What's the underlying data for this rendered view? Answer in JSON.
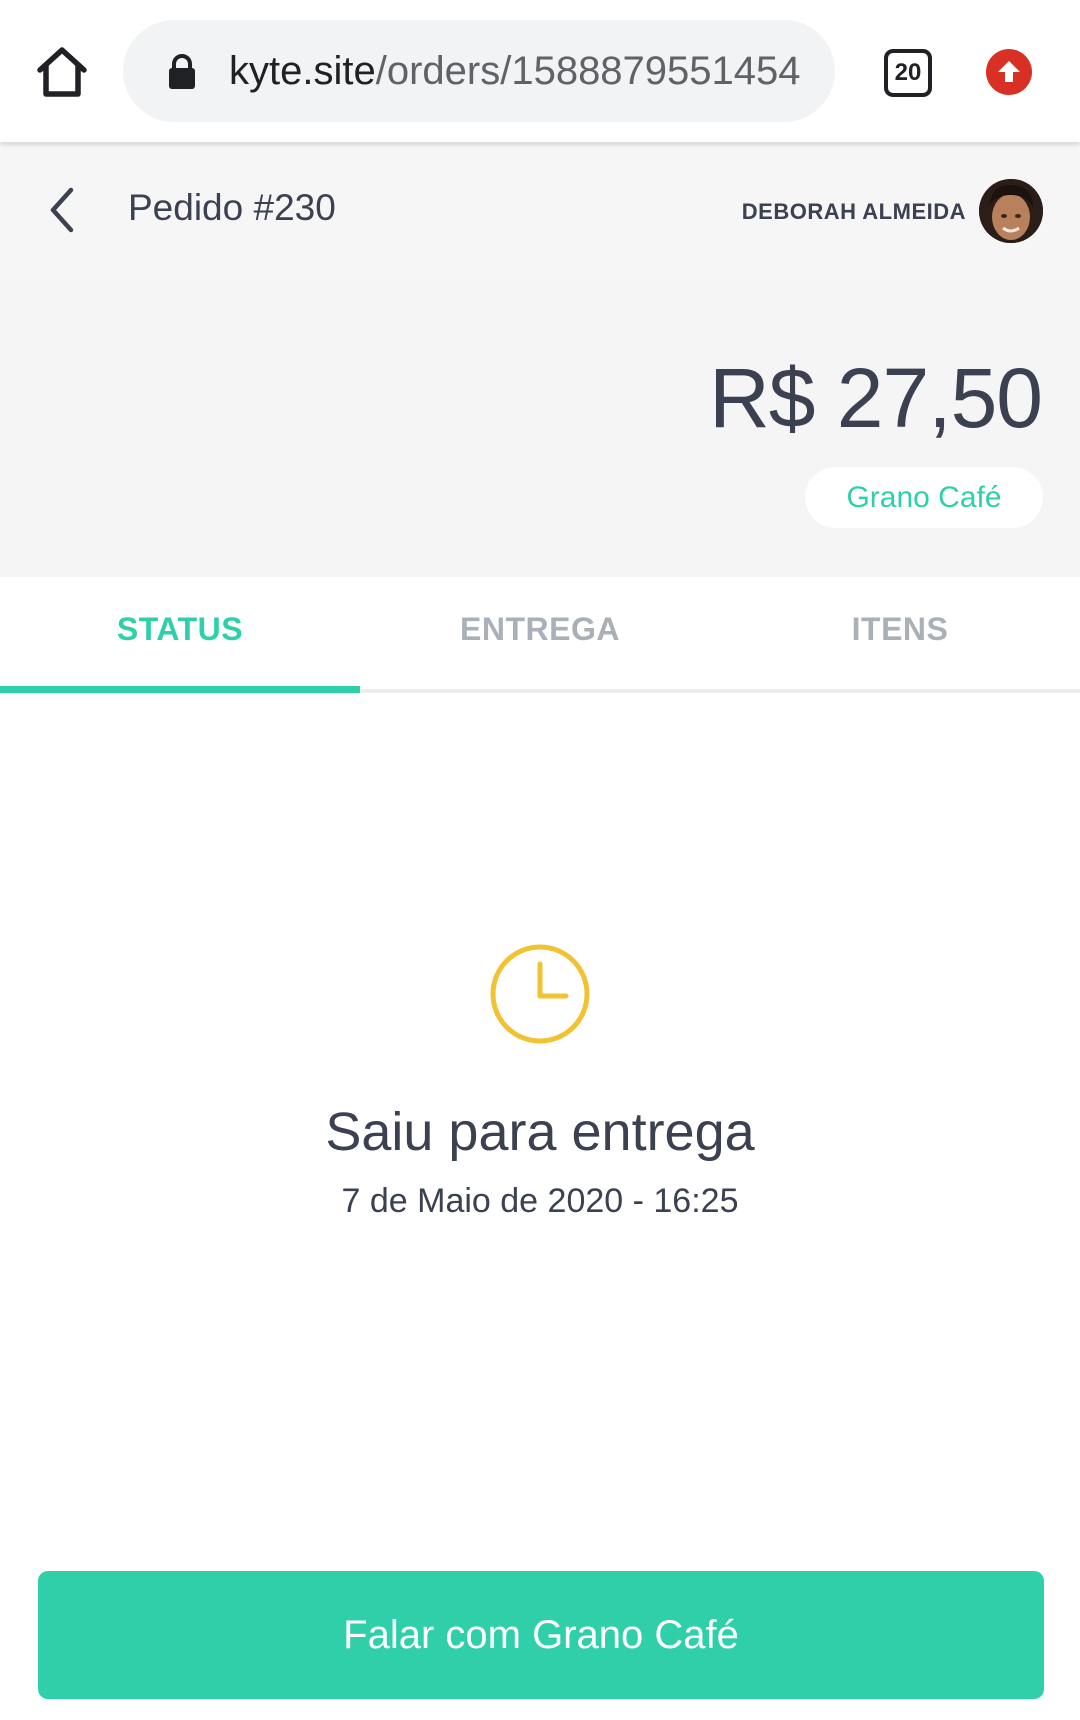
{
  "browser": {
    "url_host": "kyte.site",
    "url_path": "/orders/1588879551454",
    "tab_count": "20"
  },
  "header": {
    "title": "Pedido #230",
    "user_name": "DEBORAH ALMEIDA"
  },
  "order": {
    "total": "R$ 27,50",
    "store_name": "Grano Café"
  },
  "tabs": [
    {
      "label": "STATUS",
      "active": true
    },
    {
      "label": "ENTREGA",
      "active": false
    },
    {
      "label": "ITENS",
      "active": false
    }
  ],
  "status": {
    "icon": "clock-icon",
    "title": "Saiu para entrega",
    "date": "7 de Maio de 2020 - 16:25"
  },
  "action": {
    "contact_label": "Falar com Grano Café"
  },
  "colors": {
    "accent": "#2fd0a9",
    "status_icon": "#f1c232",
    "text": "#3b4151",
    "update_badge": "#d93025"
  }
}
